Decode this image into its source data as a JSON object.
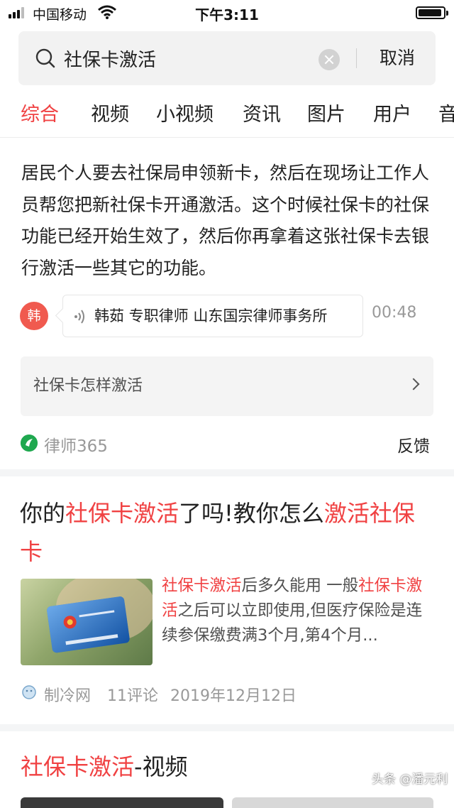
{
  "status_bar": {
    "carrier": "中国移动",
    "time": "下午3:11",
    "battery_level": 0.95
  },
  "search": {
    "query": "社保卡激活",
    "cancel_label": "取消"
  },
  "tabs": [
    {
      "label": "综合",
      "active": true
    },
    {
      "label": "视频",
      "active": false
    },
    {
      "label": "小视频",
      "active": false
    },
    {
      "label": "资讯",
      "active": false
    },
    {
      "label": "图片",
      "active": false
    },
    {
      "label": "用户",
      "active": false
    },
    {
      "label": "音",
      "active": false
    }
  ],
  "answer_card": {
    "text": "居民个人要去社保局申领新卡，然后在现场让工作人员帮您把新社保卡开通激活。这个时候社保卡的社保功能已经开始生效了，然后你再拿着这张社保卡去银行激活一些其它的功能。",
    "avatar_char": "韩",
    "lawyer_info": "韩茹 专职律师 山东国宗律师事务所",
    "duration": "00:48",
    "related_query": "社保卡怎样激活",
    "source": "律师365",
    "feedback_label": "反馈"
  },
  "article_card": {
    "title_parts": [
      "你的",
      "社保卡激活",
      "了吗!教你怎么",
      "激活社保卡"
    ],
    "snippet_parts": [
      "社保卡激活",
      "后多久能用 一般",
      "社保卡激活",
      "之后可以立即使用,但医疗保险是连续参保缴费满3个月,第4个月..."
    ],
    "source": "制冷网",
    "comments": "11评论",
    "date": "2019年12月12日"
  },
  "video_section": {
    "title_highlight": "社保卡激活",
    "title_rest": "-视频"
  },
  "watermark": "头条 @潘元利",
  "colors": {
    "accent": "#f04142",
    "text": "#222222",
    "muted": "#999999"
  }
}
